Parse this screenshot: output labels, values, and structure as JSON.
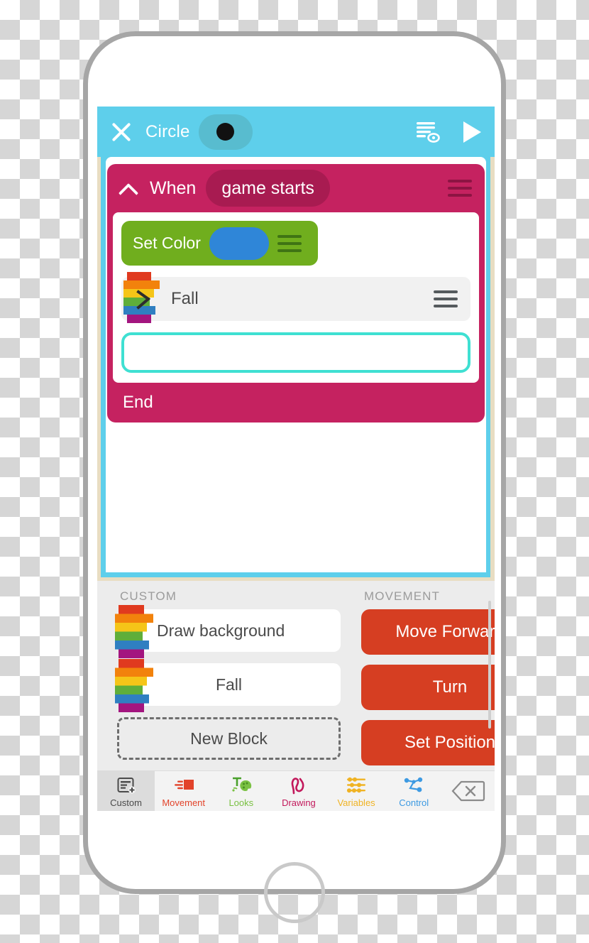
{
  "app": {
    "topbar": {
      "close_icon": "close-x-icon",
      "project_title": "Circle",
      "sprite_icon": "black-circle-sprite",
      "list_icon": "list-eye-icon",
      "play_icon": "play-triangle-icon"
    },
    "script": {
      "collapse_icon": "chevron-up-icon",
      "when_label": "When",
      "event_label": "game starts",
      "menu_icon": "hamburger-menu-icon",
      "commands": [
        {
          "kind": "set-color",
          "label": "Set Color",
          "color_value": "#2f86d8",
          "menu_icon": "hamburger-menu-icon"
        },
        {
          "kind": "custom",
          "label": "Fall",
          "icon": "rainbow-custom-block-icon",
          "menu_icon": "hamburger-menu-icon"
        }
      ],
      "empty_slot_label": "",
      "end_label": "End"
    },
    "palette": {
      "custom": {
        "title": "CUSTOM",
        "items": [
          {
            "label": "Draw background",
            "icon": "rainbow-custom-block-icon"
          },
          {
            "label": "Fall",
            "icon": "rainbow-custom-block-icon"
          }
        ],
        "new_block_label": "New Block"
      },
      "movement": {
        "title": "MOVEMENT",
        "items": [
          {
            "label": "Move Forward"
          },
          {
            "label": "Turn"
          },
          {
            "label": "Set Position"
          }
        ]
      }
    },
    "tabs": [
      {
        "label": "Custom",
        "icon": "custom-block-add-icon",
        "color": "#4a4a4a",
        "active": true
      },
      {
        "label": "Movement",
        "icon": "movement-icon",
        "color": "#e2432a",
        "active": false
      },
      {
        "label": "Looks",
        "icon": "looks-palette-icon",
        "color": "#7ac143",
        "active": false
      },
      {
        "label": "Drawing",
        "icon": "drawing-squiggle-icon",
        "color": "#c2185b",
        "active": false
      },
      {
        "label": "Variables",
        "icon": "variables-sliders-icon",
        "color": "#f0b323",
        "active": false
      },
      {
        "label": "Control",
        "icon": "control-nodes-icon",
        "color": "#3d9ae2",
        "active": false
      }
    ],
    "delete_icon": "delete-backspace-icon",
    "colors": {
      "topbar": "#5ecfeb",
      "script_block": "#c52260",
      "event_pill": "#a81b51",
      "set_color_block": "#70ae1e",
      "movement_block": "#d63e22",
      "drop_slot_outline": "#3fe0d2",
      "canvas_frame": "#e8ddc2",
      "palette_bg": "#ececec"
    }
  }
}
